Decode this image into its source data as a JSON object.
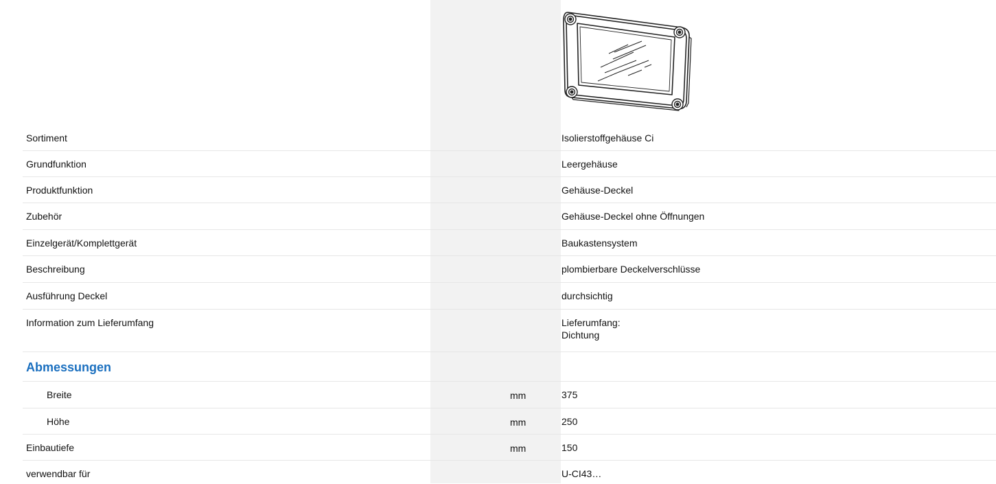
{
  "rows": [
    {
      "label": "Sortiment",
      "value": "Isolierstoffgehäuse Ci"
    },
    {
      "label": "Grundfunktion",
      "value": "Leergehäuse"
    },
    {
      "label": "Produktfunktion",
      "value": "Gehäuse-Deckel"
    },
    {
      "label": "Zubehör",
      "value": "Gehäuse-Deckel ohne Öffnungen"
    },
    {
      "label": "Einzelgerät/Komplettgerät",
      "value": "Baukastensystem"
    },
    {
      "label": "Beschreibung",
      "value": "plombierbare Deckelverschlüsse"
    },
    {
      "label": "Ausführung Deckel",
      "value": "durchsichtig"
    },
    {
      "label": "Information zum Lieferumfang",
      "value_line1": "Lieferumfang:",
      "value_line2": "Dichtung"
    }
  ],
  "section": {
    "title": "Abmessungen"
  },
  "dimensions": [
    {
      "label": "Breite",
      "unit": "mm",
      "value": "375"
    },
    {
      "label": "Höhe",
      "unit": "mm",
      "value": "250"
    }
  ],
  "extra": [
    {
      "label": "Einbautiefe",
      "unit": "mm",
      "value": "150"
    },
    {
      "label": "verwendbar für",
      "value": "U-CI43…"
    }
  ],
  "product_image": {
    "icon": "enclosure-cover-icon"
  }
}
